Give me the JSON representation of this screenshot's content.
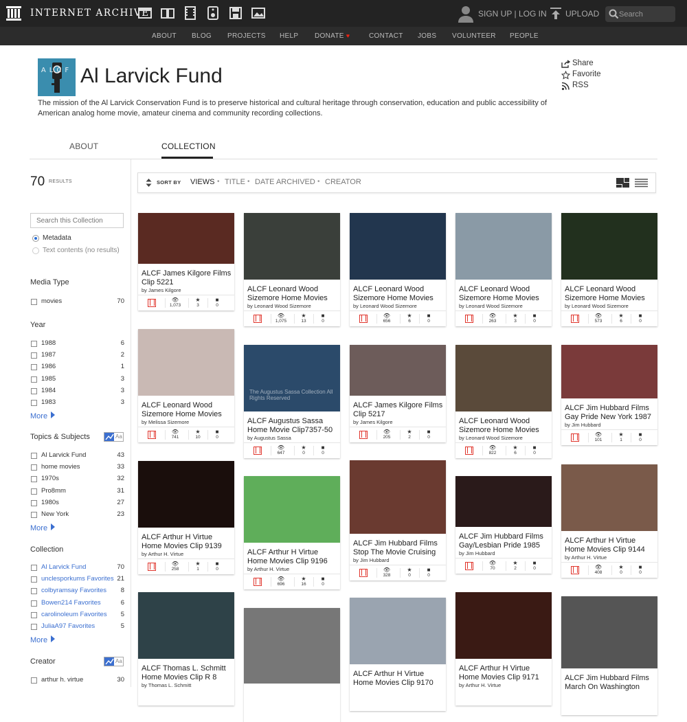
{
  "topbar": {
    "brand": "INTERNET ARCHIVE",
    "signup": "SIGN UP",
    "pipe": "|",
    "login": "LOG IN",
    "upload": "UPLOAD",
    "search_placeholder": "Search"
  },
  "nav": [
    "ABOUT",
    "BLOG",
    "PROJECTS",
    "HELP",
    "DONATE",
    "CONTACT",
    "JOBS",
    "VOLUNTEER",
    "PEOPLE"
  ],
  "collection": {
    "logo_text": "ALCF",
    "title": "Al Larvick Fund",
    "description": "The mission of the Al Larvick Conservation Fund is to preserve historical and cultural heritage through conservation, education and public accessibility of American analog home movie, amateur cinema and community recording collections.",
    "actions": [
      "Share",
      "Favorite",
      "RSS"
    ]
  },
  "tabs": [
    "ABOUT",
    "COLLECTION"
  ],
  "results": {
    "count": "70",
    "label": "RESULTS"
  },
  "sidebar": {
    "search_placeholder": "Search this Collection",
    "radio": [
      "Metadata",
      "Text contents (no results)"
    ],
    "toggle_label": "Aa",
    "media_type": {
      "head": "Media Type",
      "items": [
        {
          "label": "movies",
          "count": "70"
        }
      ]
    },
    "year": {
      "head": "Year",
      "items": [
        {
          "label": "1988",
          "count": "6"
        },
        {
          "label": "1987",
          "count": "2"
        },
        {
          "label": "1986",
          "count": "1"
        },
        {
          "label": "1985",
          "count": "3"
        },
        {
          "label": "1984",
          "count": "3"
        },
        {
          "label": "1983",
          "count": "3"
        }
      ],
      "more": "More"
    },
    "topics": {
      "head": "Topics & Subjects",
      "items": [
        {
          "label": "Al Larvick Fund",
          "count": "43"
        },
        {
          "label": "home movies",
          "count": "33"
        },
        {
          "label": "1970s",
          "count": "32"
        },
        {
          "label": "Pro8mm",
          "count": "31"
        },
        {
          "label": "1980s",
          "count": "27"
        },
        {
          "label": "New York",
          "count": "23"
        }
      ],
      "more": "More"
    },
    "collection": {
      "head": "Collection",
      "items": [
        {
          "label": "Al Larvick Fund",
          "count": "70"
        },
        {
          "label": "unclesporkums Favorites",
          "count": "21"
        },
        {
          "label": "colbyramsay Favorites",
          "count": "8"
        },
        {
          "label": "Bowen214 Favorites",
          "count": "6"
        },
        {
          "label": "carolinoleum Favorites",
          "count": "5"
        },
        {
          "label": "JuliaA97 Favorites",
          "count": "5"
        }
      ],
      "more": "More"
    },
    "creator": {
      "head": "Creator",
      "items": [
        {
          "label": "arthur h. virtue",
          "count": "30"
        }
      ]
    }
  },
  "sort": {
    "label": "SORT BY",
    "options": [
      "VIEWS",
      "TITLE",
      "DATE ARCHIVED",
      "CREATOR"
    ],
    "dot": "•"
  },
  "items": [
    {
      "title": "ALCF James Kilgore Films Clip 5221",
      "by": "by James Kilgore",
      "views": "1,073",
      "favs": "3",
      "reviews": "0",
      "thumb_color": "#5a2a22"
    },
    {
      "title": "ALCF Leonard Wood Sizemore Home Movies",
      "by": "by Leonard Wood Sizemore",
      "views": "1,075",
      "favs": "13",
      "reviews": "0",
      "thumb_color": "#3a3f3a"
    },
    {
      "title": "ALCF Leonard Wood Sizemore Home Movies",
      "by": "by Leonard Wood Sizemore",
      "views": "656",
      "favs": "6",
      "reviews": "0",
      "thumb_color": "#22364e"
    },
    {
      "title": "ALCF Leonard Wood Sizemore Home Movies",
      "by": "by Leonard Wood Sizemore",
      "views": "263",
      "favs": "3",
      "reviews": "0",
      "thumb_color": "#8a9aa6"
    },
    {
      "title": "ALCF Leonard Wood Sizemore Home Movies",
      "by": "by Leonard Wood Sizemore",
      "views": "573",
      "favs": "6",
      "reviews": "0",
      "thumb_color": "#22301e"
    },
    {
      "title": "ALCF Leonard Wood Sizemore Home Movies",
      "by": "by Melissa Sizemore",
      "views": "741",
      "favs": "10",
      "reviews": "0",
      "thumb_color": "#c9b9b4"
    },
    {
      "title": "ALCF Augustus Sassa Home Movie Clip7357-50",
      "by": "by Augustus Sassa",
      "views": "647",
      "favs": "0",
      "reviews": "0",
      "thumb_color": "#2b4a6a",
      "overlay": "The Augustus Sassa Collection All Rights Reserved"
    },
    {
      "title": "ALCF James Kilgore Films Clip 5217",
      "by": "by James Kilgore",
      "views": "205",
      "favs": "2",
      "reviews": "0",
      "thumb_color": "#6d5c5a"
    },
    {
      "title": "ALCF Leonard Wood Sizemore Home Movies",
      "by": "by Leonard Wood Sizemore",
      "views": "822",
      "favs": "6",
      "reviews": "0",
      "thumb_color": "#5a4a3a"
    },
    {
      "title": "ALCF Jim Hubbard Films Gay Pride New York 1987",
      "by": "by Jim Hubbard",
      "views": "101",
      "favs": "1",
      "reviews": "0",
      "thumb_color": "#7a3a3a"
    },
    {
      "title": "ALCF Arthur H Virtue Home Movies Clip 9139",
      "by": "by Arthur H. Virtue",
      "views": "258",
      "favs": "1",
      "reviews": "0",
      "thumb_color": "#1a0e0c"
    },
    {
      "title": "ALCF Arthur H Virtue Home Movies Clip 9196",
      "by": "by Arthur H. Virtue",
      "views": "696",
      "favs": "16",
      "reviews": "0",
      "thumb_color": "#5fae5a"
    },
    {
      "title": "ALCF Jim Hubbard Films Stop The Movie Cruising",
      "by": "by Jim Hubbard",
      "views": "328",
      "favs": "0",
      "reviews": "0",
      "thumb_color": "#6a3a30"
    },
    {
      "title": "ALCF Jim Hubbard Films Gay/Lesbian Pride 1985",
      "by": "by Jim Hubbard",
      "views": "70",
      "favs": "2",
      "reviews": "0",
      "thumb_color": "#2a1a1a"
    },
    {
      "title": "ALCF Arthur H Virtue Home Movies Clip 9144",
      "by": "by Arthur H. Virtue",
      "views": "408",
      "favs": "0",
      "reviews": "0",
      "thumb_color": "#7a5a4a"
    },
    {
      "title": "ALCF Thomas L. Schmitt Home Movies Clip R 8",
      "by": "by Thomas L. Schmitt",
      "thumb_color": "#2e4248"
    },
    {
      "title": "",
      "by": "",
      "thumb_color": "#777777"
    },
    {
      "title": "ALCF Arthur H Virtue Home Movies Clip 9170",
      "by": "",
      "thumb_color": "#9aa4b0"
    },
    {
      "title": "ALCF Arthur H Virtue Home Movies Clip 9171",
      "by": "by Arthur H. Virtue",
      "thumb_color": "#3a1a14"
    },
    {
      "title": "ALCF Jim Hubbard Films March On Washington",
      "by": "",
      "thumb_color": "#555555"
    }
  ]
}
